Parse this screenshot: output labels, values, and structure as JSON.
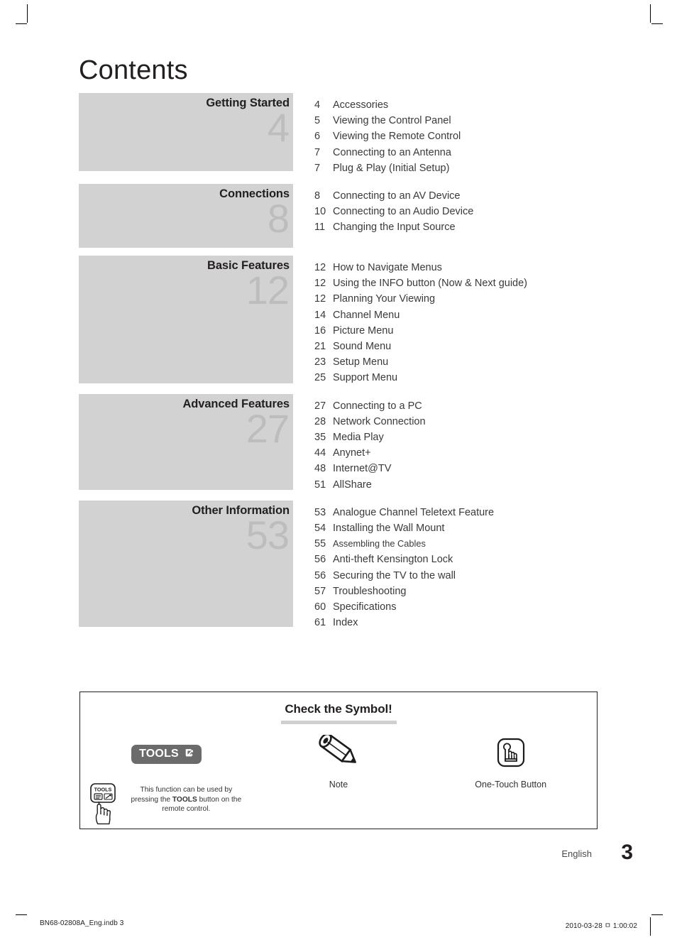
{
  "page": {
    "title": "Contents",
    "language": "English",
    "page_number": "3"
  },
  "sections": [
    {
      "title": "Getting Started",
      "number": "4",
      "entries": [
        {
          "page": "4",
          "label": "Accessories"
        },
        {
          "page": "5",
          "label": "Viewing the Control Panel"
        },
        {
          "page": "6",
          "label": "Viewing the Remote Control"
        },
        {
          "page": "7",
          "label": "Connecting to an Antenna"
        },
        {
          "page": "7",
          "label": "Plug & Play (Initial Setup)"
        }
      ]
    },
    {
      "title": "Connections",
      "number": "8",
      "entries": [
        {
          "page": "8",
          "label": "Connecting to an AV Device"
        },
        {
          "page": "10",
          "label": "Connecting to an Audio Device"
        },
        {
          "page": "11",
          "label": "Changing the Input Source"
        }
      ]
    },
    {
      "title": "Basic Features",
      "number": "12",
      "entries": [
        {
          "page": "12",
          "label": "How to Navigate Menus"
        },
        {
          "page": "12",
          "label": "Using the INFO button (Now & Next guide)"
        },
        {
          "page": "12",
          "label": "Planning Your Viewing"
        },
        {
          "page": "14",
          "label": "Channel Menu"
        },
        {
          "page": "16",
          "label": "Picture Menu"
        },
        {
          "page": "21",
          "label": "Sound Menu"
        },
        {
          "page": "23",
          "label": "Setup Menu"
        },
        {
          "page": "25",
          "label": "Support Menu"
        }
      ]
    },
    {
      "title": "Advanced Features",
      "number": "27",
      "entries": [
        {
          "page": "27",
          "label": "Connecting to a PC"
        },
        {
          "page": "28",
          "label": "Network Connection"
        },
        {
          "page": "35",
          "label": "Media Play"
        },
        {
          "page": "44",
          "label": "Anynet+"
        },
        {
          "page": "48",
          "label": "Internet@TV"
        },
        {
          "page": "51",
          "label": "AllShare"
        }
      ]
    },
    {
      "title": "Other Information",
      "number": "53",
      "entries": [
        {
          "page": "53",
          "label": "Analogue Channel Teletext Feature"
        },
        {
          "page": "54",
          "label": "Installing the Wall Mount"
        },
        {
          "page": "55",
          "label": "Assembling the Cables",
          "small": true
        },
        {
          "page": "56",
          "label": "Anti-theft Kensington Lock"
        },
        {
          "page": "56",
          "label": "Securing the TV to the wall"
        },
        {
          "page": "57",
          "label": "Troubleshooting"
        },
        {
          "page": "60",
          "label": "Specifications"
        },
        {
          "page": "61",
          "label": "Index"
        }
      ]
    }
  ],
  "symbol_box": {
    "heading": "Check the Symbol!",
    "tools": {
      "pill_label": "TOOLS",
      "key_label": "TOOLS",
      "description_line1": "This function can be used by",
      "description_line2_pre": "pressing the ",
      "description_line2_bold": "TOOLS",
      "description_line2_post": " button on the",
      "description_line3": "remote control."
    },
    "note": {
      "caption": "Note"
    },
    "one_touch": {
      "caption": "One-Touch Button"
    }
  },
  "print_footer": {
    "left": "BN68-02808A_Eng.indb   3",
    "right": "2010-03-28   ㅁ 1:00:02"
  },
  "colors": {
    "band_background": "#d2d2d2",
    "band_number": "#bdbdbd",
    "tools_pill": "#6b6b6b",
    "symbol_underline": "#cfcfcf",
    "text": "#231f20"
  }
}
